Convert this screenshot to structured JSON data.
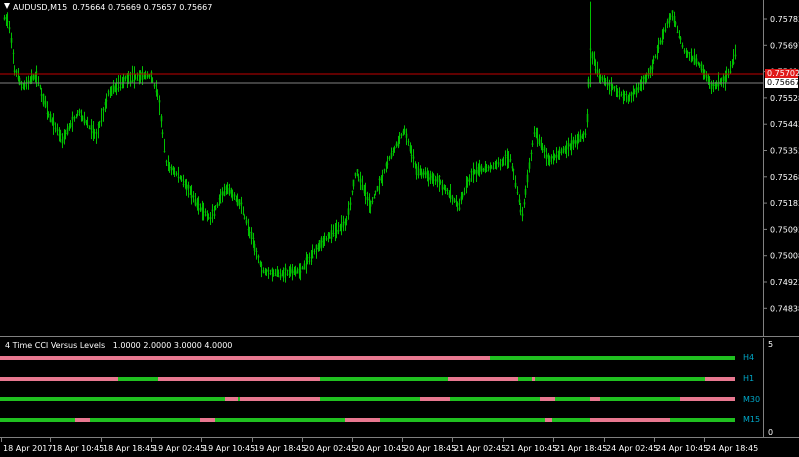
{
  "chart": {
    "symbol_line": "AUDUSD,M15",
    "ohlc": [
      "0.75664",
      "0.75669",
      "0.75657",
      "0.75667"
    ],
    "ask_price": "0.75702",
    "bid_price": "0.75667",
    "colors": {
      "background": "#000000",
      "candles": "#00c000",
      "ask_line": "#c00000",
      "bid_line": "#808080",
      "axis": "#808080",
      "text": "#ffffff"
    }
  },
  "price_axis": {
    "ticks": [
      "0.75783",
      "0.75697",
      "0.75613",
      "0.75528",
      "0.75443",
      "0.75353",
      "0.75268",
      "0.75183",
      "0.75093",
      "0.75008",
      "0.74923",
      "0.74838"
    ]
  },
  "indicator": {
    "title": "4 Time CCI Versus Levels",
    "params": [
      "1.0000",
      "2.0000",
      "3.0000",
      "4.0000"
    ],
    "axis_max": "5",
    "axis_min": "0",
    "rows": [
      {
        "label": "H4",
        "level": 4
      },
      {
        "label": "H1",
        "level": 3
      },
      {
        "label": "M30",
        "level": 2
      },
      {
        "label": "M15",
        "level": 1
      }
    ],
    "colors": {
      "up": "#20c020",
      "down": "#e87890",
      "label": "#00a8c8"
    }
  },
  "time_axis": {
    "ticks": [
      "18 Apr 2017",
      "18 Apr 10:45",
      "18 Apr 18:45",
      "19 Apr 02:45",
      "19 Apr 10:45",
      "19 Apr 18:45",
      "20 Apr 02:45",
      "20 Apr 10:45",
      "20 Apr 18:45",
      "21 Apr 02:45",
      "21 Apr 10:45",
      "21 Apr 18:45",
      "24 Apr 02:45",
      "24 Apr 10:45",
      "24 Apr 18:45"
    ]
  },
  "chart_data": {
    "type": "line",
    "title": "AUDUSD,M15",
    "xlabel": "",
    "ylabel": "",
    "x": [
      "18 Apr 2017",
      "18 Apr 10:45",
      "18 Apr 18:45",
      "19 Apr 02:45",
      "19 Apr 10:45",
      "19 Apr 18:45",
      "20 Apr 02:45",
      "20 Apr 10:45",
      "20 Apr 18:45",
      "21 Apr 02:45",
      "21 Apr 10:45",
      "21 Apr 18:45",
      "24 Apr 02:45",
      "24 Apr 10:45",
      "24 Apr 18:45"
    ],
    "ylim": [
      0.74838,
      0.75783
    ],
    "series": [
      {
        "values": [
          0.7575,
          0.7553,
          0.754,
          0.7562,
          0.7529,
          0.7503,
          0.7508,
          0.7531,
          0.7525,
          0.753,
          0.752,
          0.7539,
          0.7555,
          0.7576,
          0.7567
        ]
      }
    ],
    "regime_bars": {
      "rows": [
        "H4",
        "H1",
        "M30",
        "M15"
      ],
      "segments": [
        [
          [
            "down",
            0,
            490
          ],
          [
            "up",
            490,
            735
          ]
        ],
        [
          [
            "down",
            0,
            118
          ],
          [
            "up",
            118,
            158
          ],
          [
            "down",
            158,
            320
          ],
          [
            "up",
            320,
            448
          ],
          [
            "down",
            448,
            518
          ],
          [
            "up",
            518,
            532
          ],
          [
            "down",
            532,
            535
          ],
          [
            "up",
            535,
            705
          ],
          [
            "down",
            705,
            735
          ]
        ],
        [
          [
            "up",
            0,
            225
          ],
          [
            "down",
            225,
            238
          ],
          [
            "up",
            238,
            240
          ],
          [
            "down",
            240,
            320
          ],
          [
            "up",
            320,
            420
          ],
          [
            "down",
            420,
            450
          ],
          [
            "up",
            450,
            540
          ],
          [
            "down",
            540,
            555
          ],
          [
            "up",
            555,
            590
          ],
          [
            "down",
            590,
            600
          ],
          [
            "up",
            600,
            680
          ],
          [
            "down",
            680,
            735
          ]
        ],
        [
          [
            "up",
            0,
            75
          ],
          [
            "down",
            75,
            90
          ],
          [
            "up",
            90,
            200
          ],
          [
            "down",
            200,
            215
          ],
          [
            "up",
            215,
            345
          ],
          [
            "down",
            345,
            380
          ],
          [
            "up",
            380,
            545
          ],
          [
            "down",
            545,
            552
          ],
          [
            "up",
            552,
            590
          ],
          [
            "down",
            590,
            670
          ],
          [
            "up",
            670,
            735
          ]
        ]
      ]
    }
  }
}
